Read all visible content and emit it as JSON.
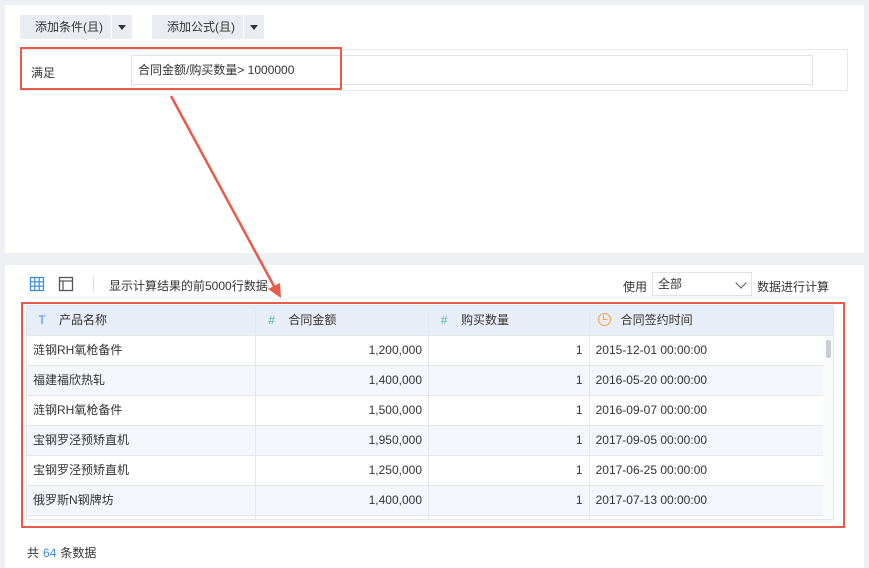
{
  "toolbar": {
    "add_condition": "添加条件(且)",
    "add_formula": "添加公式(且)"
  },
  "condition": {
    "label": "满足",
    "expression": "合同金额/购买数量> 1000000"
  },
  "result_bar": {
    "hint": "显示计算结果的前5000行数据",
    "use_label": "使用",
    "scope_selected": "全部",
    "calc_label": "数据进行计算"
  },
  "table": {
    "columns": [
      {
        "label": "产品名称",
        "type_icon": "text-type-icon"
      },
      {
        "label": "合同金额",
        "type_icon": "number-type-icon"
      },
      {
        "label": "购买数量",
        "type_icon": "number-type-icon"
      },
      {
        "label": "合同签约时间",
        "type_icon": "date-type-icon"
      }
    ],
    "rows": [
      [
        "涟钢RH氧枪备件",
        "1,200,000",
        "1",
        "2015-12-01 00:00:00"
      ],
      [
        "福建福欣热轧",
        "1,400,000",
        "1",
        "2016-05-20 00:00:00"
      ],
      [
        "涟钢RH氧枪备件",
        "1,500,000",
        "1",
        "2016-09-07 00:00:00"
      ],
      [
        "宝钢罗泾预矫直机",
        "1,950,000",
        "1",
        "2017-09-05 00:00:00"
      ],
      [
        "宝钢罗泾预矫直机",
        "1,250,000",
        "1",
        "2017-06-25 00:00:00"
      ],
      [
        "俄罗斯N钢牌坊",
        "1,400,000",
        "1",
        "2017-07-13 00:00:00"
      ],
      [
        "",
        "",
        "",
        ""
      ]
    ]
  },
  "footer": {
    "prefix": "共",
    "count": "64",
    "suffix": "条数据"
  },
  "colors": {
    "highlight": "#e85a4a",
    "accent": "#3d8ee5",
    "number_icon": "#4ab8a2",
    "date_icon": "#f0a13a"
  }
}
